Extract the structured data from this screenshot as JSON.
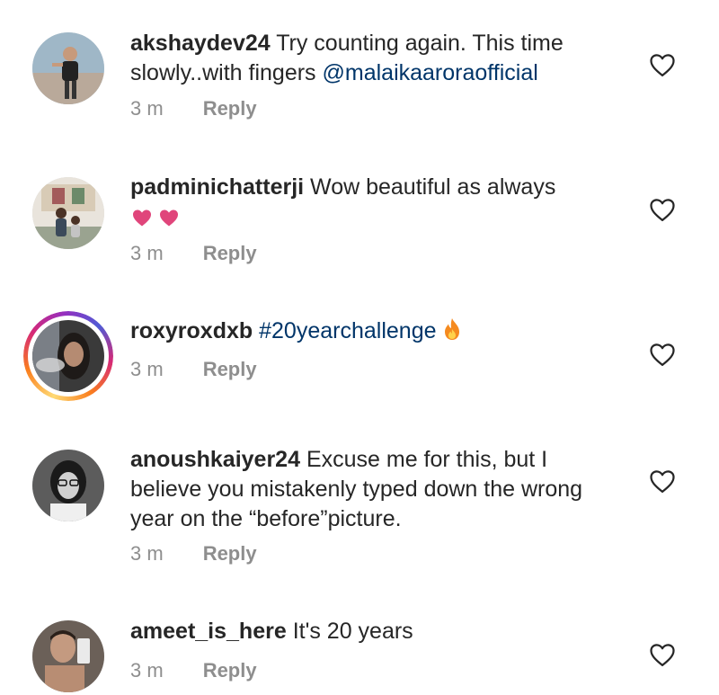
{
  "colors": {
    "text": "#262626",
    "muted": "#8e8e8e",
    "hashtag": "#003569",
    "heart_emoji": "#e0457b"
  },
  "comments": [
    {
      "username": "akshaydev24",
      "text_lines": [
        "Try counting again. This time",
        "slowly..with fingers "
      ],
      "mention": "@malaikaaroraofficial",
      "time": "3 m",
      "reply": "Reply",
      "like_icon": "heart-outline-icon"
    },
    {
      "username": "padminichatterji",
      "text": "Wow beautiful as always",
      "emoji": "two-pink-hearts",
      "time": "3 m",
      "reply": "Reply",
      "like_icon": "heart-outline-icon"
    },
    {
      "username": "roxyroxdxb",
      "hashtag": "#20yearchallenge",
      "emoji": "fire",
      "time": "3 m",
      "reply": "Reply",
      "like_icon": "heart-outline-icon"
    },
    {
      "username": "anoushkaiyer24",
      "text_lines": [
        "Excuse me for this, but I",
        "believe you mistakenly typed down the wrong",
        "year on the “before”picture."
      ],
      "time": "3 m",
      "reply": "Reply",
      "like_icon": "heart-outline-icon"
    },
    {
      "username": "ameet_is_here",
      "text": "It's 20 years",
      "time": "3 m",
      "reply": "Reply",
      "like_icon": "heart-outline-icon"
    }
  ]
}
